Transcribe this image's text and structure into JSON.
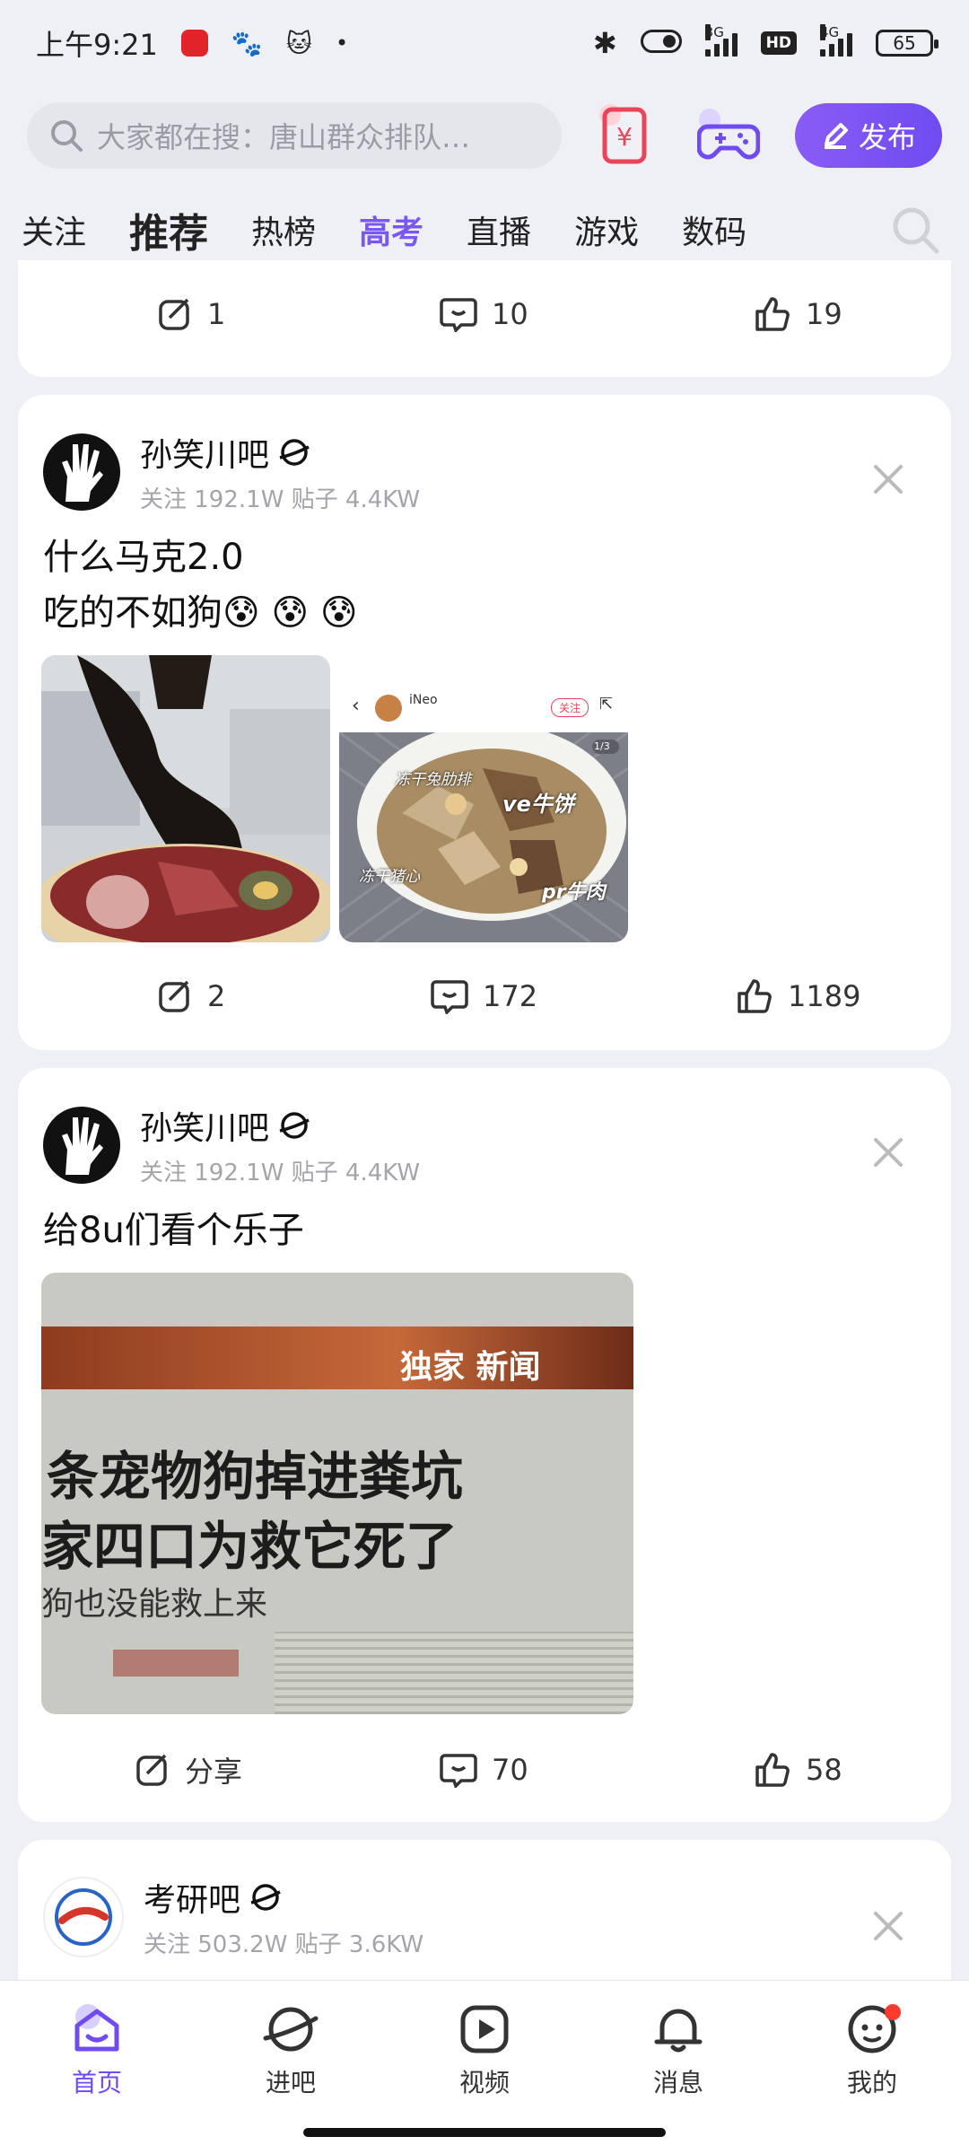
{
  "status_bar": {
    "time": "上午9:21",
    "net3g": "3G",
    "hd": "HD",
    "net4g": "4G",
    "battery": "65"
  },
  "top": {
    "search_placeholder": "大家都在搜：唐山群众排队…",
    "publish_label": "发布"
  },
  "tabs": [
    {
      "label": "关注"
    },
    {
      "label": "推荐"
    },
    {
      "label": "热榜"
    },
    {
      "label": "高考"
    },
    {
      "label": "直播"
    },
    {
      "label": "游戏"
    },
    {
      "label": "数码"
    }
  ],
  "feed": {
    "card0": {
      "share_count": "1",
      "comment_count": "10",
      "like_count": "19"
    },
    "card1": {
      "author": "孙笑川吧",
      "meta": "关注 192.1W   贴子 4.4KW",
      "line1": "什么马克2.0",
      "line2": "吃的不如狗😰 😰 😰",
      "img2_username": "iNeo",
      "img2_follow": "关注",
      "img2_page": "1/3",
      "img2_labels": [
        "冻干兔肋排",
        "ve牛饼",
        "冻干猪心",
        "pr牛肉"
      ],
      "share_count": "2",
      "comment_count": "172",
      "like_count": "1189"
    },
    "card2": {
      "author": "孙笑川吧",
      "meta": "关注 192.1W   贴子 4.4KW",
      "text": "给8u们看个乐子",
      "img_banner": "独家 新闻",
      "img_line1": "条宠物狗掉进粪坑",
      "img_line2": "家四口为救它死了",
      "img_line3": "狗也没能救上来",
      "share_label": "分享",
      "comment_count": "70",
      "like_count": "58"
    },
    "card3": {
      "author": "考研吧",
      "meta": "关注 503.2W   贴子 3.6KW"
    }
  },
  "bottom_nav": [
    {
      "label": "首页"
    },
    {
      "label": "进吧"
    },
    {
      "label": "视频"
    },
    {
      "label": "消息"
    },
    {
      "label": "我的"
    }
  ],
  "colors": {
    "accent": "#6f4bf0",
    "badge": "#ff3b30",
    "background": "#eef0f5"
  }
}
